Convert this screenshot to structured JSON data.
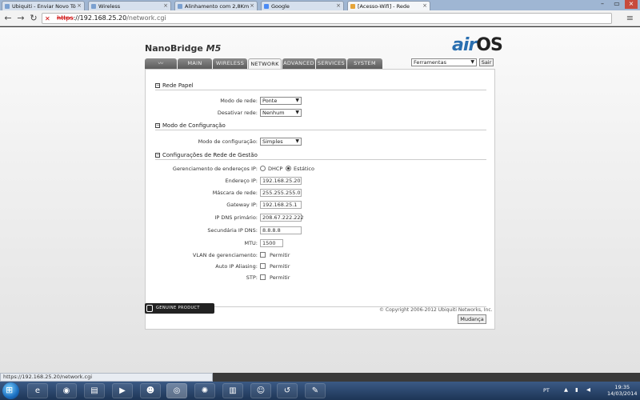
{
  "browser": {
    "tabs": [
      {
        "label": "Ubiquiti - Enviar Novo Tó",
        "active": false
      },
      {
        "label": "Wireless",
        "active": false
      },
      {
        "label": "Alinhamento com 2,8Km",
        "active": false
      },
      {
        "label": "Google",
        "active": false
      },
      {
        "label": "[Acesso-Wifi] - Rede",
        "active": true
      }
    ],
    "url_scheme": "https",
    "url_host": "://192.168.25.20",
    "url_path": "/network.cgi",
    "status_url": "https://192.168.25.20/network.cgi"
  },
  "header": {
    "device": "NanoBridge",
    "model": "M5",
    "logo_air": "air",
    "logo_os": "OS",
    "tools_label": "Ferramentas",
    "logout_label": "Sair"
  },
  "nav": {
    "tabs": [
      "MAIN",
      "WIRELESS",
      "NETWORK",
      "ADVANCED",
      "SERVICES",
      "SYSTEM"
    ],
    "active": "NETWORK"
  },
  "sections": {
    "role": {
      "title": "Rede Papel",
      "mode_label": "Modo de rede:",
      "mode_value": "Ponte",
      "disable_label": "Desativar rede:",
      "disable_value": "Nenhum"
    },
    "config": {
      "title": "Modo de Configuração",
      "mode_label": "Modo de configuração:",
      "mode_value": "Simples"
    },
    "mgmt": {
      "title": "Configurações de Rede de Gestão",
      "ip_mgmt_label": "Gerenciamento de endereços IP:",
      "dhcp_label": "DHCP",
      "static_label": "Estático",
      "ip_label": "Endereço IP:",
      "ip_value": "192.168.25.20",
      "mask_label": "Máscara de rede:",
      "mask_value": "255.255.255.0",
      "gateway_label": "Gateway IP:",
      "gateway_value": "192.168.25.1",
      "dns1_label": "IP DNS primário:",
      "dns1_value": "208.67.222.222",
      "dns2_label": "Secundária IP DNS:",
      "dns2_value": "8.8.8.8",
      "mtu_label": "MTU:",
      "mtu_value": "1500",
      "vlan_label": "VLAN de gerenciamento:",
      "alias_label": "Auto IP Aliasing:",
      "stp_label": "STP:",
      "permit_label": "Permitir"
    }
  },
  "actions": {
    "apply_label": "Mudança"
  },
  "footer": {
    "badge": "GENUINE PRODUCT",
    "copyright": "© Copyright 2006-2012 Ubiquiti Networks, Inc."
  },
  "taskbar": {
    "lang": "PT",
    "time": "19:35",
    "date": "14/03/2014"
  },
  "colors": {
    "brand_blue": "#2a6fb0",
    "nav_dark": "#5c5c5c"
  }
}
